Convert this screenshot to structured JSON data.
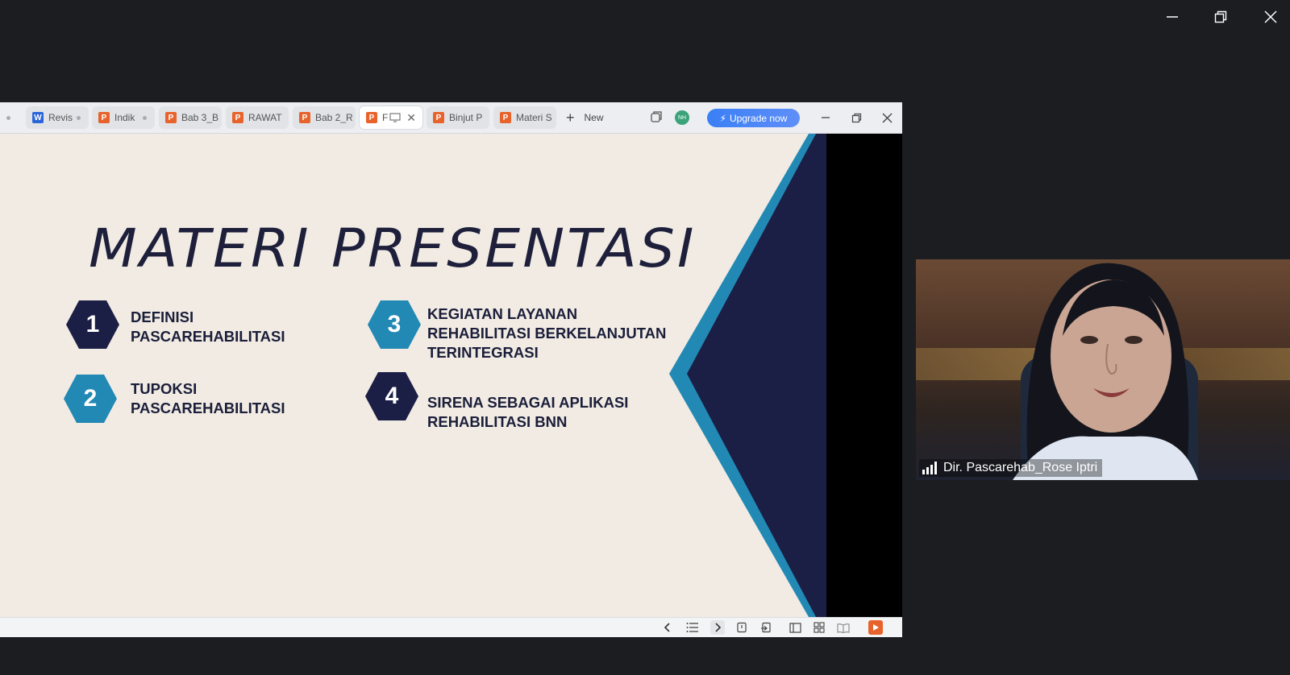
{
  "window": {
    "controls": [
      "minimize-icon",
      "restore-icon",
      "close-icon"
    ]
  },
  "app": {
    "tabs": [
      {
        "type": "w",
        "icon_letter": "W",
        "label": "Revis",
        "state": "dot"
      },
      {
        "type": "p",
        "icon_letter": "P",
        "label": "Indik",
        "state": "dot"
      },
      {
        "type": "p",
        "icon_letter": "P",
        "label": "Bab 3_B",
        "state": "none"
      },
      {
        "type": "p",
        "icon_letter": "P",
        "label": "RAWAT",
        "state": "none"
      },
      {
        "type": "p",
        "icon_letter": "P",
        "label": "Bab 2_R",
        "state": "none"
      },
      {
        "type": "p",
        "icon_letter": "P",
        "label": "F",
        "state": "active"
      },
      {
        "type": "p",
        "icon_letter": "P",
        "label": "Binjut P",
        "state": "none"
      },
      {
        "type": "p",
        "icon_letter": "P",
        "label": "Materi S",
        "state": "none"
      }
    ],
    "new_tab_label": "New",
    "avatar_initials": "NH",
    "upgrade_label": "Upgrade now",
    "colors": {
      "accent_blue": "#3a7ff5",
      "ppt_orange": "#e8632b",
      "word_blue": "#2b66d9"
    }
  },
  "slide": {
    "title": "MATERI PRESENTASI",
    "items": [
      {
        "number": "1",
        "color": "#1b1f45",
        "lines": [
          "DEFINISI",
          "PASCAREHABILITASI"
        ]
      },
      {
        "number": "2",
        "color": "#2289b5",
        "lines": [
          "TUPOKSI",
          "PASCAREHABILITASI"
        ]
      },
      {
        "number": "3",
        "color": "#2289b5",
        "lines": [
          "KEGIATAN LAYANAN",
          "REHABILITASI BERKELANJUTAN",
          "TERINTEGRASI"
        ]
      },
      {
        "number": "4",
        "color": "#1b1f45",
        "lines": [
          "SIRENA SEBAGAI APLIKASI",
          "REHABILITASI BNN"
        ]
      }
    ],
    "colors": {
      "background": "#f1ebe3",
      "navy": "#1b1f45",
      "teal": "#2289b5"
    }
  },
  "video": {
    "participant_name": "Dir. Pascarehab_Rose Iptri"
  }
}
